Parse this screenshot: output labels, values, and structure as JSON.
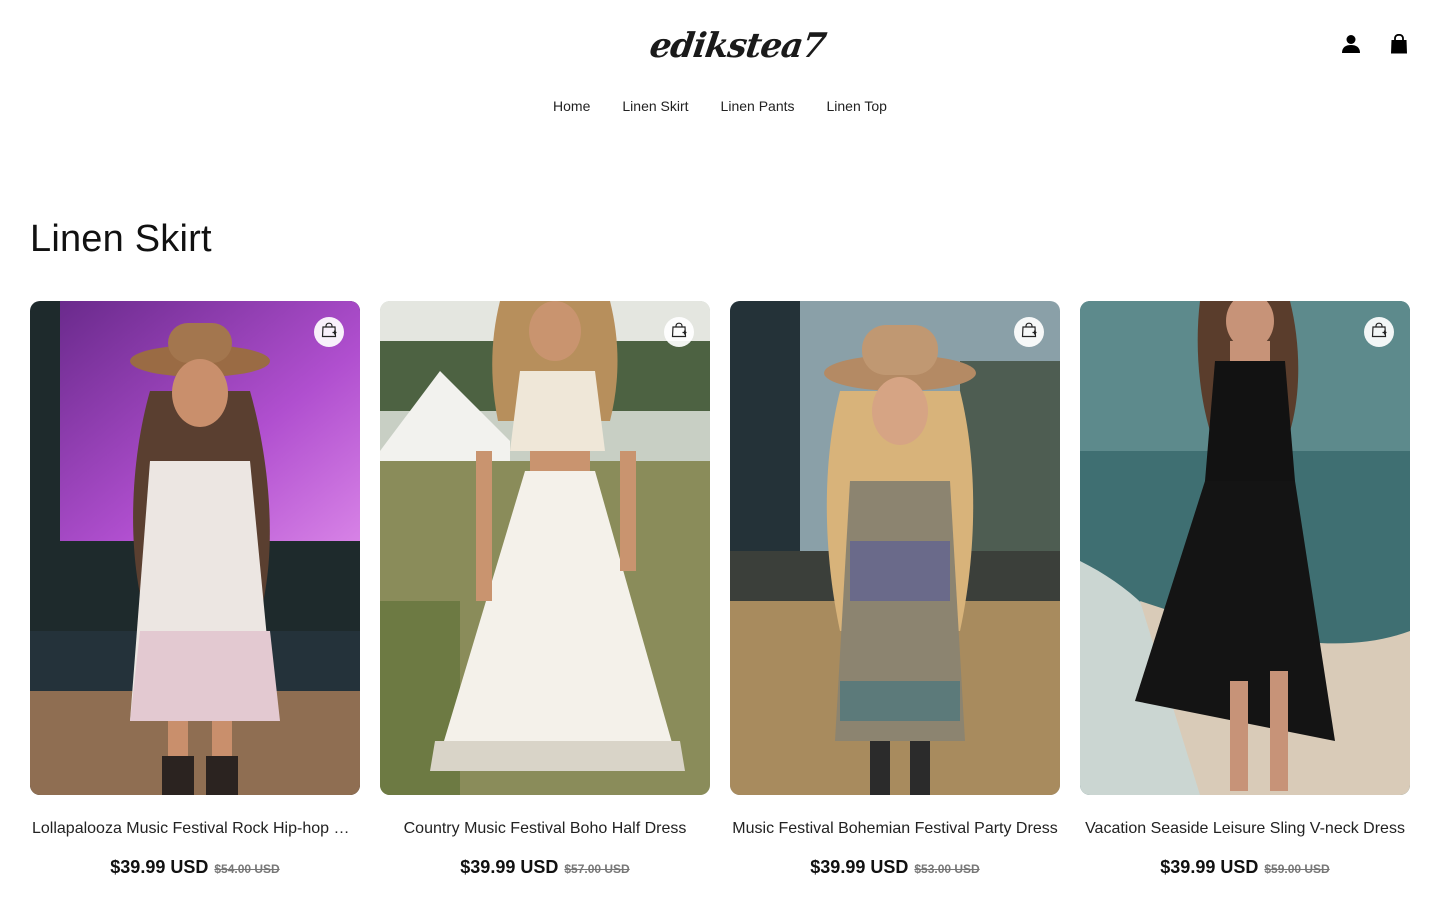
{
  "header": {
    "logo_text": "edikstea7",
    "account_icon": "account-icon",
    "cart_icon": "cart-icon"
  },
  "nav": {
    "items": [
      {
        "label": "Home"
      },
      {
        "label": "Linen Skirt"
      },
      {
        "label": "Linen Pants"
      },
      {
        "label": "Linen Top"
      }
    ]
  },
  "collection": {
    "title": "Linen Skirt"
  },
  "products": [
    {
      "title": "Lollapalooza Music Festival Rock Hip-hop Boho Dress",
      "price": "$39.99 USD",
      "compare_price": "$54.00 USD"
    },
    {
      "title": "Country Music Festival Boho Half Dress",
      "price": "$39.99 USD",
      "compare_price": "$57.00 USD"
    },
    {
      "title": "Music Festival Bohemian Festival Party Dress",
      "price": "$39.99 USD",
      "compare_price": "$53.00 USD"
    },
    {
      "title": "Vacation Seaside Leisure Sling V-neck Dress",
      "price": "$39.99 USD",
      "compare_price": "$59.00 USD"
    }
  ],
  "colors": {
    "text": "#111111",
    "muted": "#777777",
    "background": "#ffffff"
  }
}
